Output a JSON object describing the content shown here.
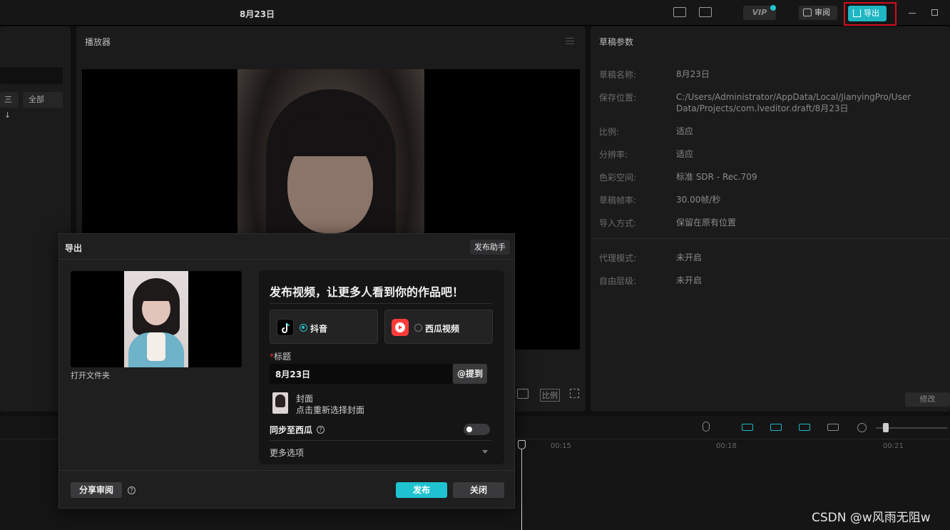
{
  "window": {
    "title": "8月23日"
  },
  "topbar": {
    "vip_label": "VIP",
    "review_label": "审阅",
    "export_label": "导出"
  },
  "left_panel": {
    "sort_label": "三↓",
    "filter_label": "全部"
  },
  "player": {
    "title": "播放器",
    "ratio_label": "比例"
  },
  "draft": {
    "title": "草稿参数",
    "rows": [
      {
        "k": "草稿名称:",
        "v": "8月23日"
      },
      {
        "k": "保存位置:",
        "v": "C:/Users/Administrator/AppData/Local/JianyingPro/User Data/Projects/com.lveditor.draft/8月23日"
      },
      {
        "k": "比例:",
        "v": "适应"
      },
      {
        "k": "分辨率:",
        "v": "适应"
      },
      {
        "k": "色彩空间:",
        "v": "标准 SDR - Rec.709"
      },
      {
        "k": "草稿帧率:",
        "v": "30.00帧/秒"
      },
      {
        "k": "导入方式:",
        "v": "保留在原有位置"
      },
      {
        "k": "代理模式:",
        "v": "未开启"
      },
      {
        "k": "自由层级:",
        "v": "未开启"
      }
    ],
    "modify_label": "修改"
  },
  "timeline": {
    "ticks": [
      "00:15",
      "00:18",
      "00:21"
    ]
  },
  "dialog": {
    "title": "导出",
    "assist_label": "发布助手",
    "open_folder": "打开文件夹",
    "headline": "发布视频，让更多人看到你的作品吧！",
    "platforms": [
      {
        "name": "抖音",
        "selected": true,
        "color": "#000000"
      },
      {
        "name": "西瓜视频",
        "selected": false,
        "color": "#ff3b3b"
      }
    ],
    "title_label": "标题",
    "title_required": "*",
    "title_value": "8月23日",
    "mention_label": "@提到",
    "cover_title": "封面",
    "cover_sub": "点击重新选择封面",
    "sync_label": "同步至西瓜",
    "more_label": "更多选项",
    "share_label": "分享审阅",
    "publish_label": "发布",
    "close_label": "关闭"
  },
  "watermark": "CSDN @w风雨无阻w",
  "colors": {
    "accent": "#1fb7c3",
    "highlight": "#d10f1d"
  }
}
